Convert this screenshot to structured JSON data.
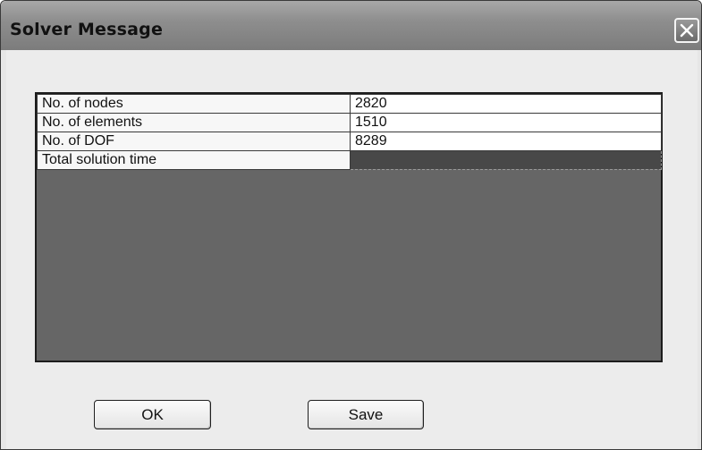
{
  "window": {
    "title": "Solver Message"
  },
  "table": {
    "rows": [
      {
        "label": "No. of nodes",
        "value": "2820"
      },
      {
        "label": "No. of elements",
        "value": "1510"
      },
      {
        "label": "No. of DOF",
        "value": "8289"
      },
      {
        "label": "Total solution time",
        "value": ""
      }
    ]
  },
  "buttons": {
    "ok_label": "OK",
    "save_label": "Save"
  },
  "icons": {
    "close": "close-icon"
  },
  "colors": {
    "titlebar": "#8e8e8e",
    "grid_background": "#666666",
    "cell_background": "#ffffff"
  }
}
